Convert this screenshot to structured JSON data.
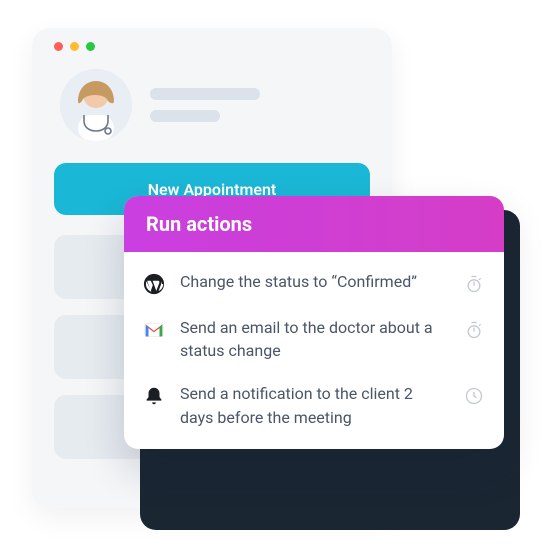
{
  "profile": {
    "new_appointment_label": "New Appointment"
  },
  "actions": {
    "header": "Run actions",
    "items": [
      {
        "icon": "wordpress",
        "text": "Change the status to “Confirmed”",
        "timing": "timer"
      },
      {
        "icon": "gmail",
        "text": "Send an email to the doctor about a status change",
        "timing": "timer"
      },
      {
        "icon": "bell",
        "text": "Send a notification to the client 2 days before the meeting",
        "timing": "clock"
      }
    ]
  }
}
